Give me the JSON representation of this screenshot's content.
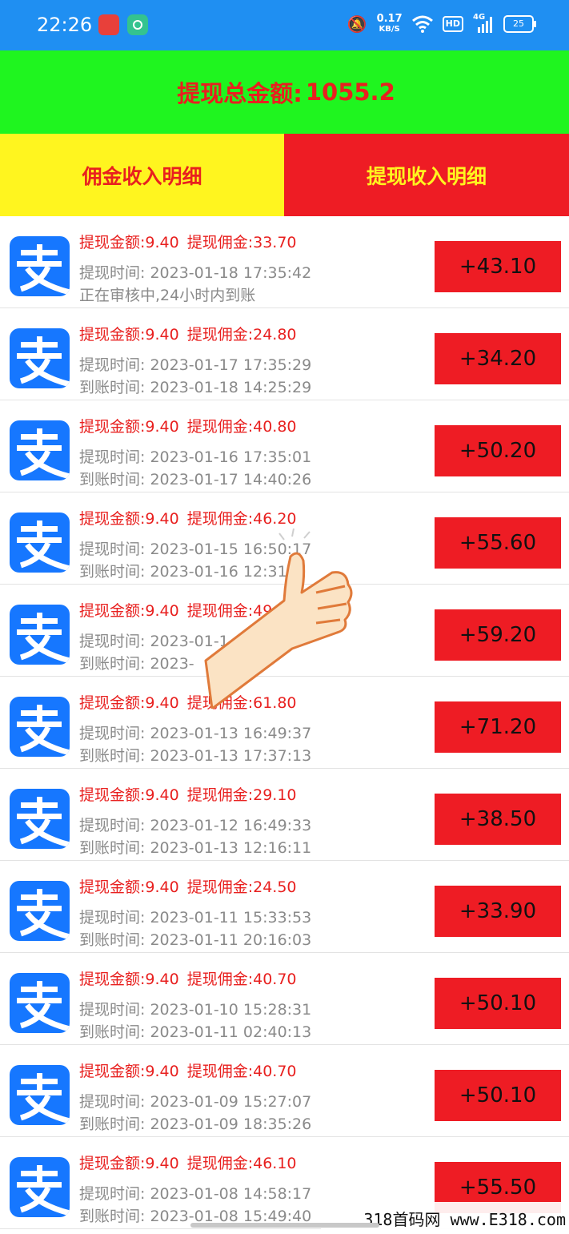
{
  "status_bar": {
    "time": "22:26",
    "net_speed_value": "0.17",
    "net_speed_unit": "KB/S",
    "hd_label": "HD",
    "signal_label": "4G",
    "battery": "25",
    "icons": [
      "mute-bell-icon",
      "wifi-icon",
      "hd-icon",
      "signal-icon",
      "battery-icon"
    ]
  },
  "summary": {
    "total_label": "提现总金额:",
    "total_value": "1055.2"
  },
  "tabs": {
    "commission_label": "佣金收入明细",
    "withdraw_label": "提现收入明细"
  },
  "records": [
    {
      "withdraw_amount": "提现金额:9.40",
      "withdraw_commission": "提现佣金:33.70",
      "withdraw_time": "提现时间: 2023-01-18 17:35:42",
      "arrival": "正在审核中,24小时内到账",
      "total": "+43.10"
    },
    {
      "withdraw_amount": "提现金额:9.40",
      "withdraw_commission": "提现佣金:24.80",
      "withdraw_time": "提现时间: 2023-01-17 17:35:29",
      "arrival": "到账时间: 2023-01-18 14:25:29",
      "total": "+34.20"
    },
    {
      "withdraw_amount": "提现金额:9.40",
      "withdraw_commission": "提现佣金:40.80",
      "withdraw_time": "提现时间: 2023-01-16 17:35:01",
      "arrival": "到账时间: 2023-01-17 14:40:26",
      "total": "+50.20"
    },
    {
      "withdraw_amount": "提现金额:9.40",
      "withdraw_commission": "提现佣金:46.20",
      "withdraw_time": "提现时间: 2023-01-15 16:50:17",
      "arrival": "到账时间: 2023-01-16 12:31",
      "total": "+55.60"
    },
    {
      "withdraw_amount": "提现金额:9.40",
      "withdraw_commission": "提现佣金:49",
      "withdraw_time": "提现时间: 2023-01-1",
      "arrival": "到账时间: 2023-",
      "total": "+59.20"
    },
    {
      "withdraw_amount": "提现金额:9.40",
      "withdraw_commission": "提现佣金:61.80",
      "withdraw_time": "提现时间: 2023-01-13 16:49:37",
      "arrival": "到账时间: 2023-01-13 17:37:13",
      "total": "+71.20"
    },
    {
      "withdraw_amount": "提现金额:9.40",
      "withdraw_commission": "提现佣金:29.10",
      "withdraw_time": "提现时间: 2023-01-12 16:49:33",
      "arrival": "到账时间: 2023-01-13 12:16:11",
      "total": "+38.50"
    },
    {
      "withdraw_amount": "提现金额:9.40",
      "withdraw_commission": "提现佣金:24.50",
      "withdraw_time": "提现时间: 2023-01-11 15:33:53",
      "arrival": "到账时间: 2023-01-11 20:16:03",
      "total": "+33.90"
    },
    {
      "withdraw_amount": "提现金额:9.40",
      "withdraw_commission": "提现佣金:40.70",
      "withdraw_time": "提现时间: 2023-01-10 15:28:31",
      "arrival": "到账时间: 2023-01-11 02:40:13",
      "total": "+50.10"
    },
    {
      "withdraw_amount": "提现金额:9.40",
      "withdraw_commission": "提现佣金:40.70",
      "withdraw_time": "提现时间: 2023-01-09 15:27:07",
      "arrival": "到账时间: 2023-01-09 18:35:26",
      "total": "+50.10"
    },
    {
      "withdraw_amount": "提现金额:9.40",
      "withdraw_commission": "提现佣金:46.10",
      "withdraw_time": "提现时间: 2023-01-08 14:58:17",
      "arrival": "到账时间: 2023-01-08 15:49:40",
      "total": "+55.50"
    }
  ],
  "watermark": "318首码网 www.E318.com",
  "colors": {
    "status_bar": "#1f8ff2",
    "banner_green": "#1ff51f",
    "tab_yellow": "#fff51f",
    "accent_red": "#ee1c24",
    "alipay_blue": "#1677ff"
  }
}
